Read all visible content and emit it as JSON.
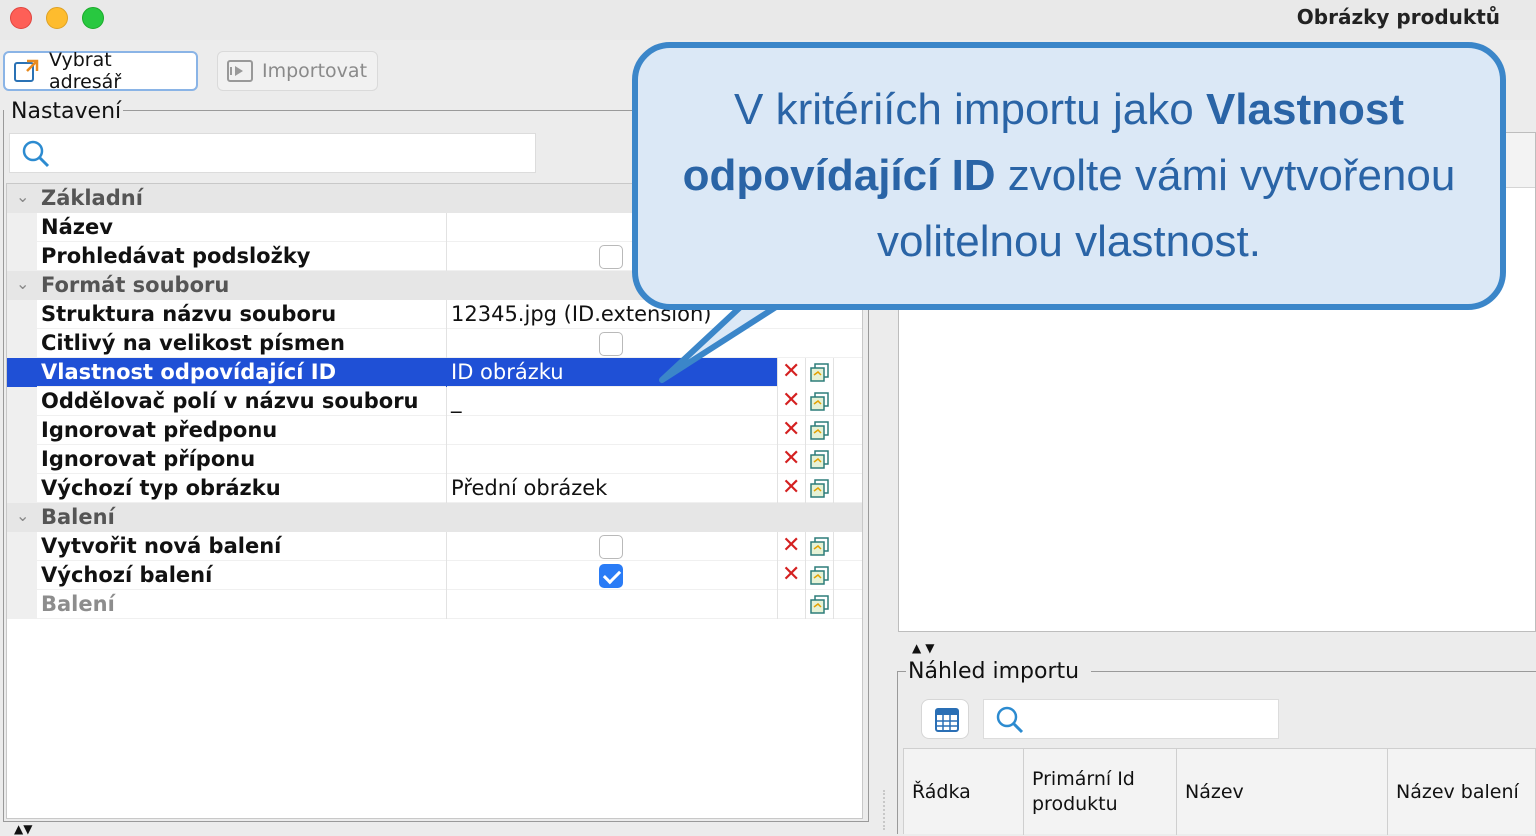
{
  "window": {
    "title": "Obrázky produktů"
  },
  "toolbar": {
    "choose_dir_label": "Vybrat adresář",
    "import_label": "Importovat"
  },
  "settings": {
    "legend": "Nastavení",
    "search_placeholder": "",
    "rows": [
      {
        "type": "category",
        "label": "Základní"
      },
      {
        "type": "property",
        "label": "Název",
        "value": ""
      },
      {
        "type": "property",
        "label": "Prohledávat podsložky",
        "checkbox": false
      },
      {
        "type": "category",
        "label": "Formát souboru"
      },
      {
        "type": "property",
        "label": "Struktura názvu souboru",
        "value": "12345.jpg (ID.extension)"
      },
      {
        "type": "property",
        "label": "Citlivý na velikost písmen",
        "checkbox": false
      },
      {
        "type": "property",
        "label": "Vlastnost odpovídající ID",
        "value": "ID obrázku",
        "selected": true
      },
      {
        "type": "property",
        "label": "Oddělovač polí v názvu souboru",
        "value": "_"
      },
      {
        "type": "property",
        "label": "Ignorovat předponu",
        "value": ""
      },
      {
        "type": "property",
        "label": "Ignorovat příponu",
        "value": ""
      },
      {
        "type": "property",
        "label": "Výchozí typ obrázku",
        "value": "Přední obrázek"
      },
      {
        "type": "category",
        "label": "Balení"
      },
      {
        "type": "property",
        "label": "Vytvořit nová balení",
        "checkbox": false
      },
      {
        "type": "property",
        "label": "Výchozí balení",
        "checkbox": true
      },
      {
        "type": "property",
        "label": "Balení",
        "value": "",
        "disabled": true
      }
    ]
  },
  "preview": {
    "legend": "Náhled importu",
    "search_placeholder": "",
    "columns": [
      "Řádka",
      "Primární Id produktu",
      "Název",
      "Název balení"
    ]
  },
  "callout": {
    "part1": "V kritériích importu jako ",
    "bold1": "Vlastnost odpovídající ID",
    "part2": " zvolte vámi vytvořenou volitelnou vlastnost."
  },
  "colors": {
    "selection": "#1f50d6",
    "callout_bg": "#dbe8f6",
    "callout_border": "#3b86c9",
    "callout_text": "#2a64a6",
    "delete_icon": "#d42020"
  },
  "icons": {
    "search": "magnifier-icon",
    "delete": "x-icon",
    "copy": "copy-icon",
    "choose_dir": "folder-arrow-icon",
    "import": "import-icon",
    "sheet": "spreadsheet-icon"
  }
}
